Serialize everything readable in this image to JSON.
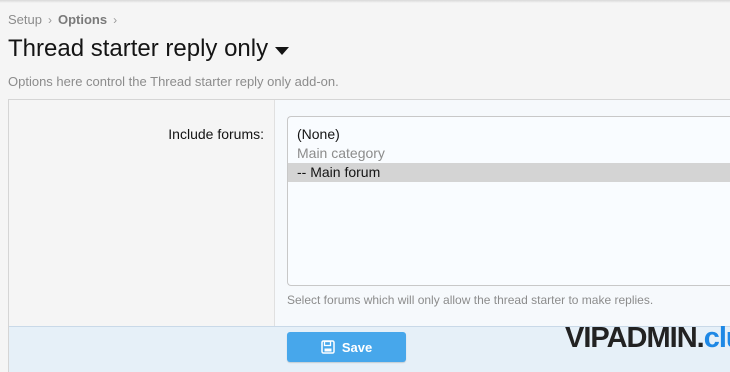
{
  "breadcrumb": {
    "items": [
      "Setup",
      "Options"
    ],
    "separator": "›"
  },
  "page": {
    "title": "Thread starter reply only",
    "description": "Options here control the Thread starter reply only add-on."
  },
  "form": {
    "field_label": "Include forums:",
    "options": [
      {
        "label": "(None)",
        "kind": "option",
        "selected": false
      },
      {
        "label": "Main category",
        "kind": "category",
        "selected": false
      },
      {
        "label": "-- Main forum",
        "kind": "option",
        "selected": true
      }
    ],
    "hint": "Select forums which will only allow the thread starter to make replies.",
    "save_label": "Save",
    "save_icon": "save-icon"
  },
  "watermark": {
    "main": "VIPADMIN",
    "dot": ".",
    "club": "club"
  },
  "colors": {
    "accent": "#47a7eb",
    "selected_option": "#d4d4d4",
    "watermark_club": "#1e88e5"
  }
}
